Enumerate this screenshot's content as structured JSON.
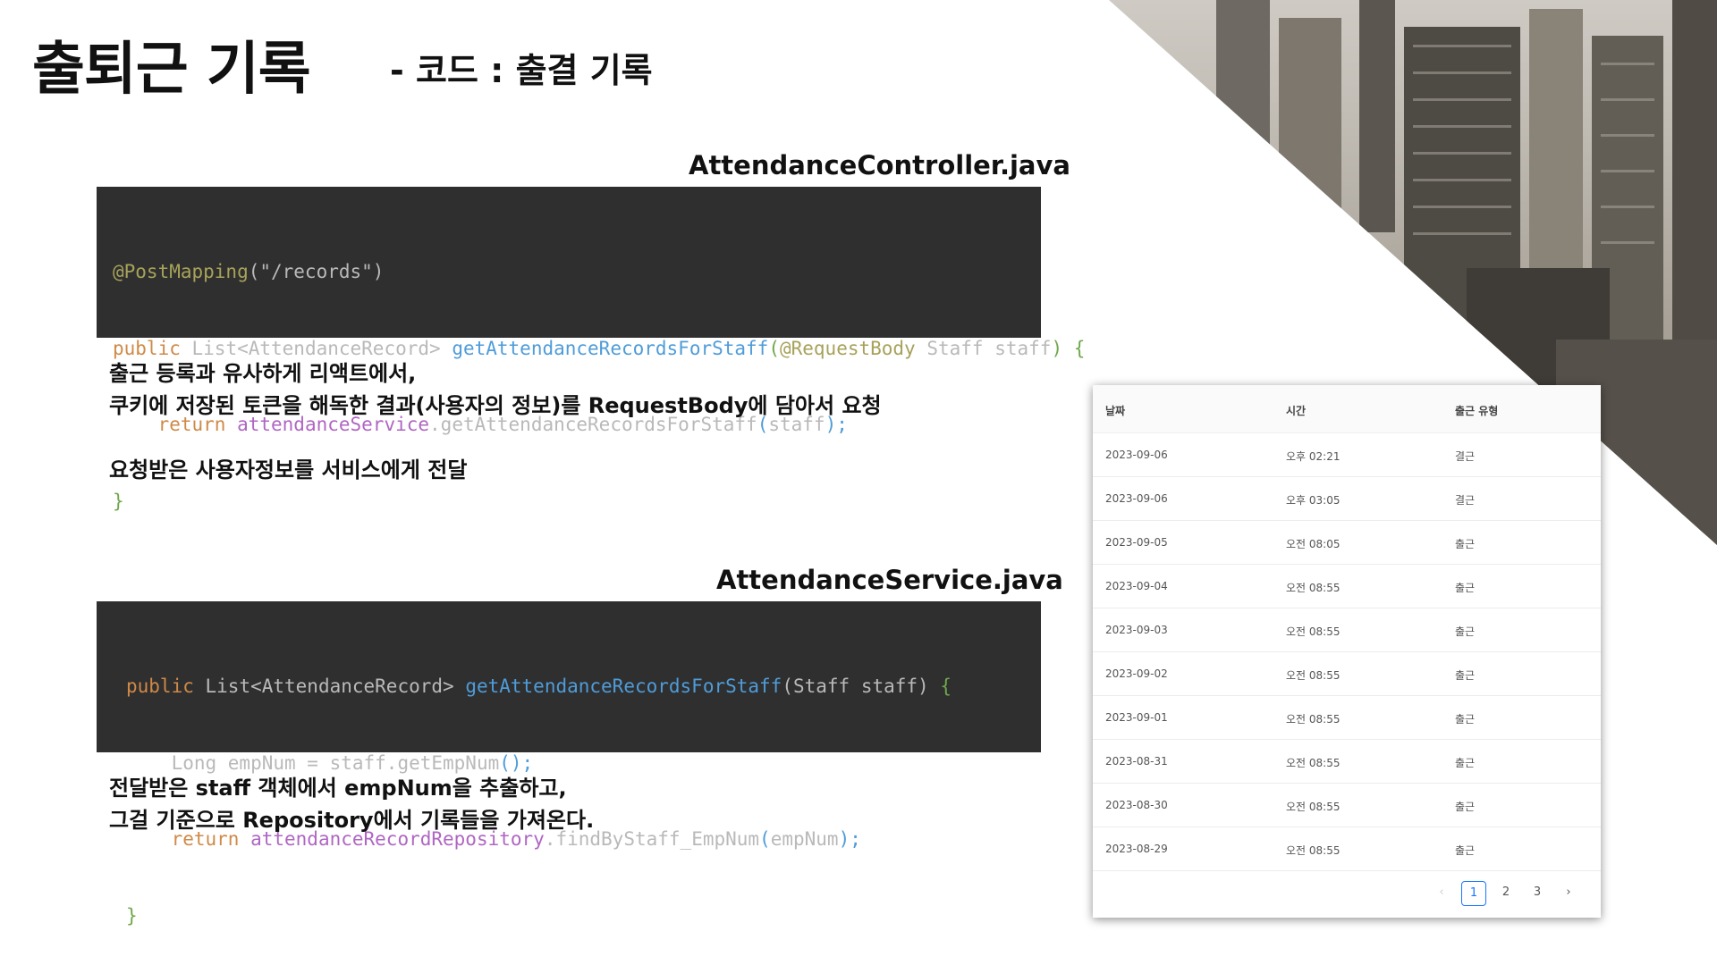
{
  "slide": {
    "title": "출퇴근 기록",
    "subtitle": "- 코드 : 출결 기록"
  },
  "controller": {
    "filename": "AttendanceController.java",
    "code": {
      "l1_annotation": "@PostMapping",
      "l1_rest": "(\"/records\")",
      "l2_public": "public ",
      "l2_type": "List<AttendanceRecord> ",
      "l2_method": "getAttendanceRecordsForStaff",
      "l2_paren_open": "(",
      "l2_param_ann": "@RequestBody ",
      "l2_param": "Staff staff",
      "l2_paren_close": ") ",
      "l2_brace": "{",
      "l3_return": "return ",
      "l3_service": "attendanceService",
      "l3_call": ".getAttendanceRecordsForStaff",
      "l3_open": "(",
      "l3_arg": "staff",
      "l3_close": ");",
      "l4_brace": "}"
    },
    "description": [
      "출근 등록과 유사하게 리액트에서,",
      "쿠키에 저장된 토큰을 해독한 결과(사용자의 정보)를 RequestBody에 담아서 요청",
      "",
      "요청받은 사용자정보를 서비스에게 전달"
    ]
  },
  "service": {
    "filename": "AttendanceService.java",
    "code": {
      "l1_public": "public ",
      "l1_type": "List<AttendanceRecord> ",
      "l1_method": "getAttendanceRecordsForStaff",
      "l1_params": "(Staff staff) ",
      "l1_brace": "{",
      "l2_text": "Long empNum = staff.getEmpNum",
      "l2_call": "();",
      "l3_return": "return ",
      "l3_repo": "attendanceRecordRepository",
      "l3_call": ".findByStaff_EmpNum",
      "l3_open": "(",
      "l3_arg": "empNum",
      "l3_close": ");",
      "l4_brace": "}"
    },
    "description": [
      "전달받은 staff 객체에서 empNum을 추출하고,",
      "그걸 기준으로 Repository에서 기록들을 가져온다."
    ]
  },
  "table": {
    "headers": [
      "날짜",
      "시간",
      "출근 유형"
    ],
    "rows": [
      [
        "2023-09-06",
        "오후 02:21",
        "결근"
      ],
      [
        "2023-09-06",
        "오후 03:05",
        "결근"
      ],
      [
        "2023-09-05",
        "오전 08:05",
        "출근"
      ],
      [
        "2023-09-04",
        "오전 08:55",
        "출근"
      ],
      [
        "2023-09-03",
        "오전 08:55",
        "출근"
      ],
      [
        "2023-09-02",
        "오전 08:55",
        "출근"
      ],
      [
        "2023-09-01",
        "오전 08:55",
        "출근"
      ],
      [
        "2023-08-31",
        "오전 08:55",
        "출근"
      ],
      [
        "2023-08-30",
        "오전 08:55",
        "출근"
      ],
      [
        "2023-08-29",
        "오전 08:55",
        "출근"
      ]
    ],
    "pagination": {
      "prev": "‹",
      "pages": [
        "1",
        "2",
        "3"
      ],
      "current": "1",
      "next": "›"
    }
  }
}
